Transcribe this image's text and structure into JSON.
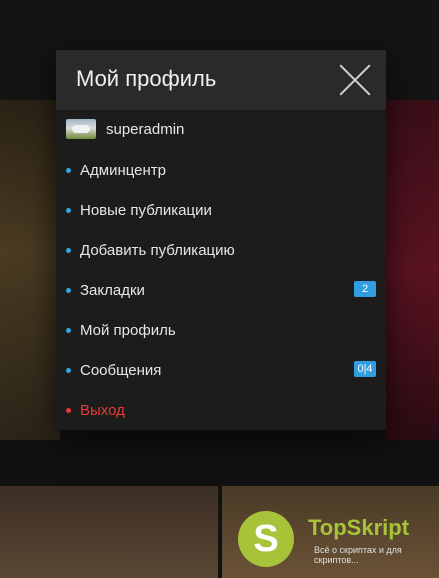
{
  "modal": {
    "title": "Мой профиль",
    "close_icon": "close-icon",
    "user": {
      "name": "superadmin",
      "avatar_icon": "avatar-image"
    },
    "menu": [
      {
        "label": "Админцентр",
        "badge": ""
      },
      {
        "label": "Новые публикации",
        "badge": ""
      },
      {
        "label": "Добавить публикацию",
        "badge": ""
      },
      {
        "label": "Закладки",
        "badge": "2"
      },
      {
        "label": "Мой профиль",
        "badge": ""
      },
      {
        "label": "Сообщения",
        "badge": "0|4"
      },
      {
        "label": "Выход",
        "badge": ""
      }
    ]
  },
  "brand": {
    "logo_letter": "S",
    "name": "TopSkript",
    "tagline": "Всё о скриптах и для скриптов..."
  },
  "colors": {
    "accent": "#3aa3e8",
    "logout": "#e83a3a",
    "brand_green": "#a7c33a",
    "badge": "#2f9de0"
  }
}
